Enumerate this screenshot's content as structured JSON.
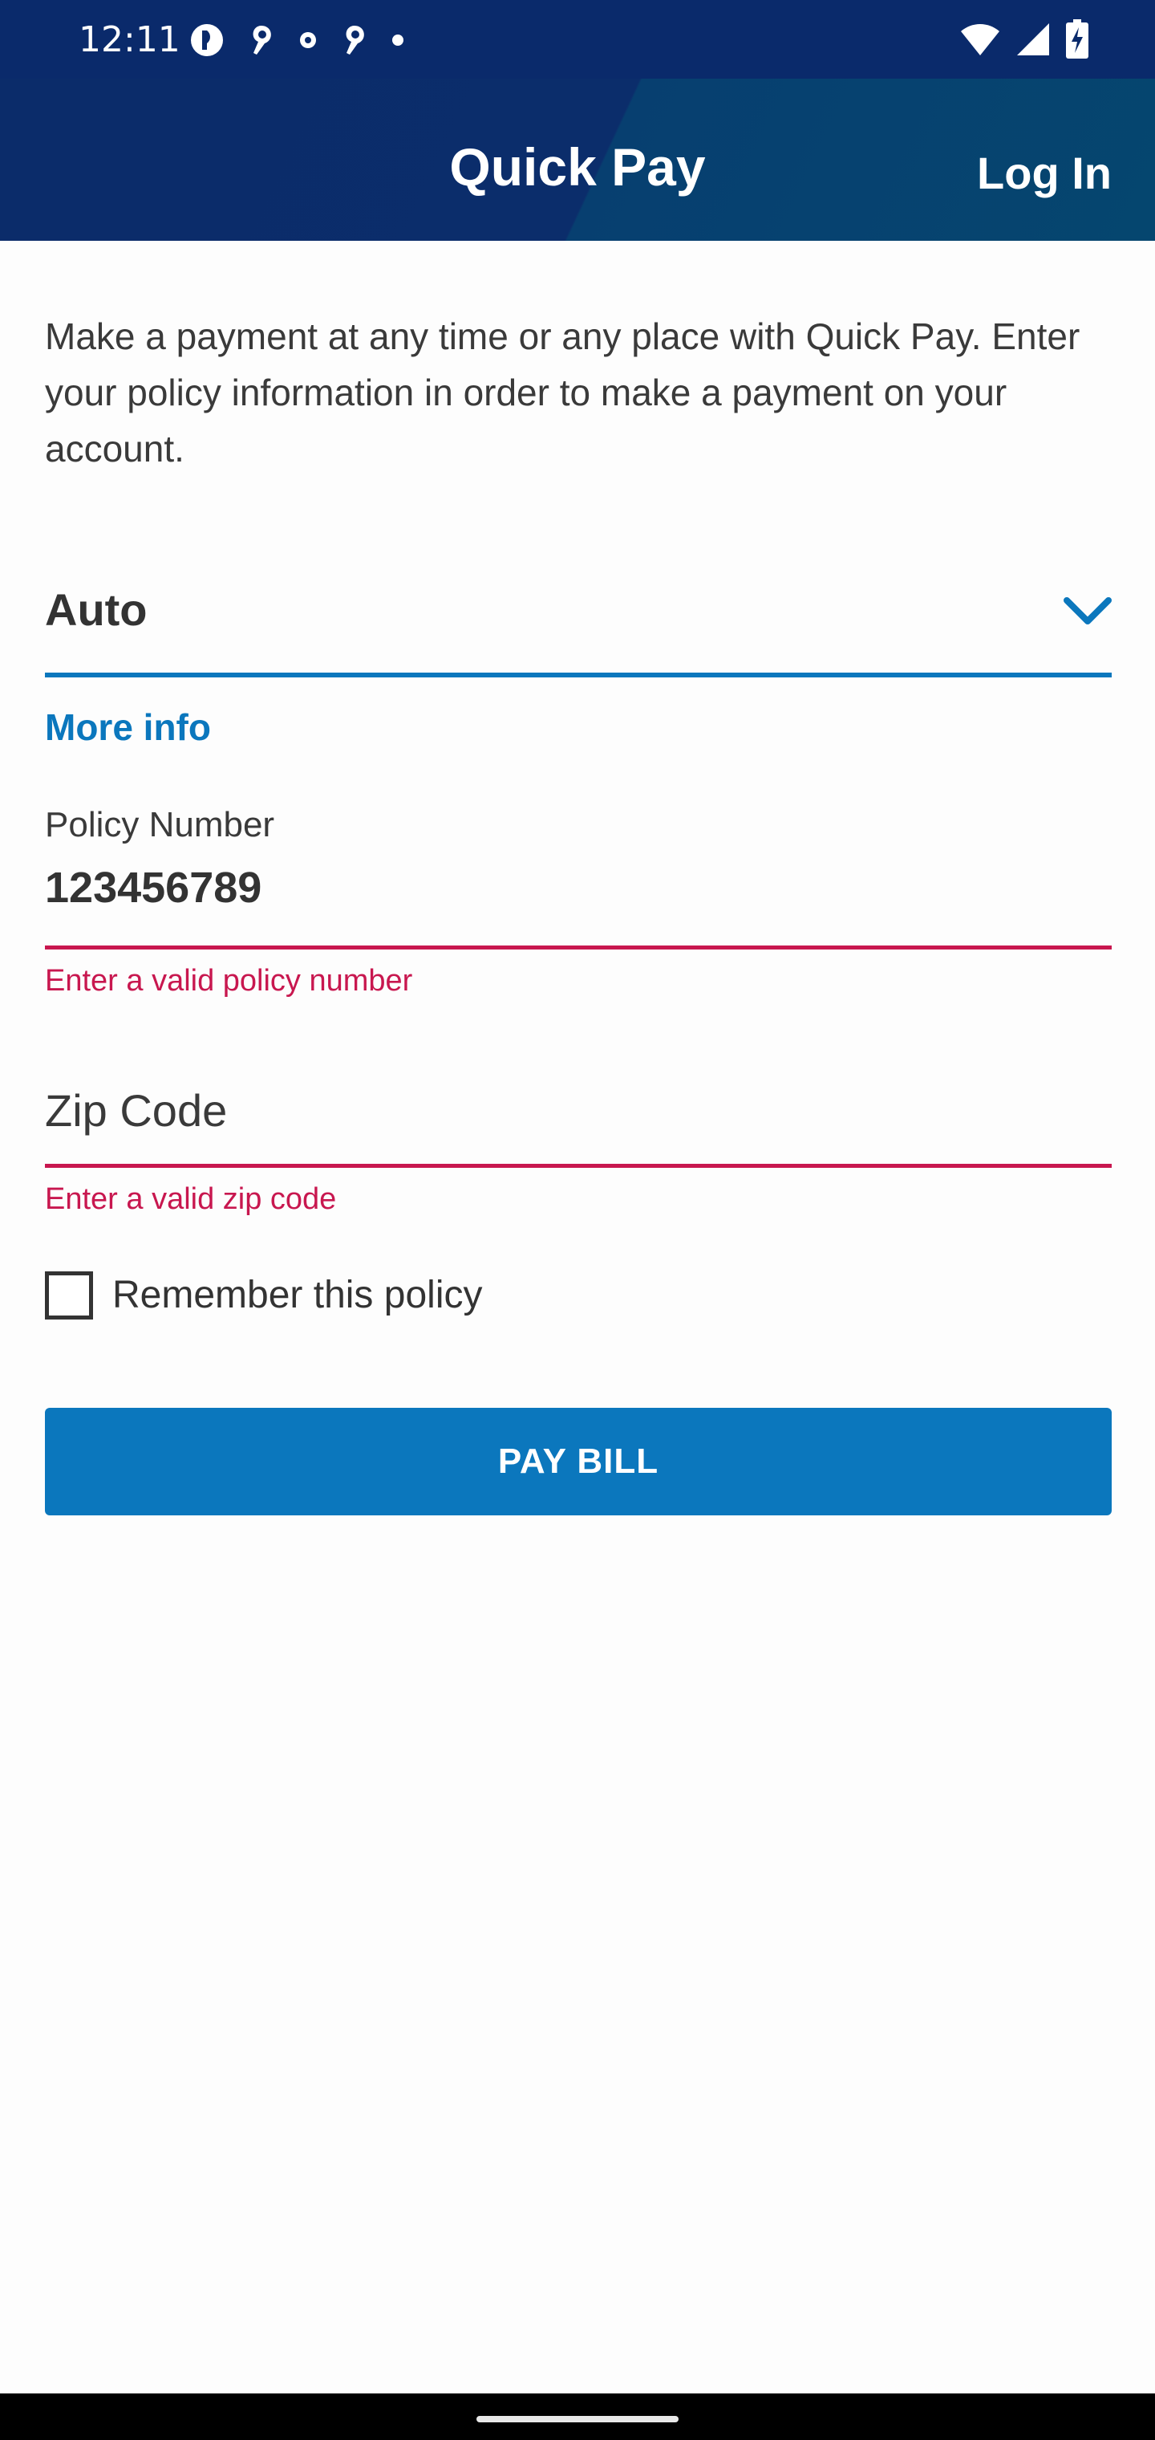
{
  "status_bar": {
    "time": "12:11",
    "left_icons": [
      "app-icon-1",
      "app-icon-2",
      "app-icon-3",
      "app-icon-4",
      "dot-icon"
    ],
    "right_icons": [
      "wifi-icon",
      "signal-icon",
      "battery-charging-icon"
    ]
  },
  "app_bar": {
    "title": "Quick Pay",
    "login_label": "Log In"
  },
  "content": {
    "intro_text": "Make a payment at any time or any place with Quick Pay. Enter your policy information in order to make a payment on your account.",
    "policy_type": {
      "selected": "Auto"
    },
    "more_info_label": "More info",
    "policy_number": {
      "label": "Policy Number",
      "value": "123456789",
      "error": "Enter a valid policy number"
    },
    "zip_code": {
      "placeholder": "Zip Code",
      "error": "Enter a valid zip code"
    },
    "remember": {
      "label": "Remember this policy",
      "checked": false
    },
    "pay_button_label": "PAY BILL"
  },
  "colors": {
    "header": "#0b2c6a",
    "accent": "#0b77bd",
    "error": "#c8174f"
  }
}
